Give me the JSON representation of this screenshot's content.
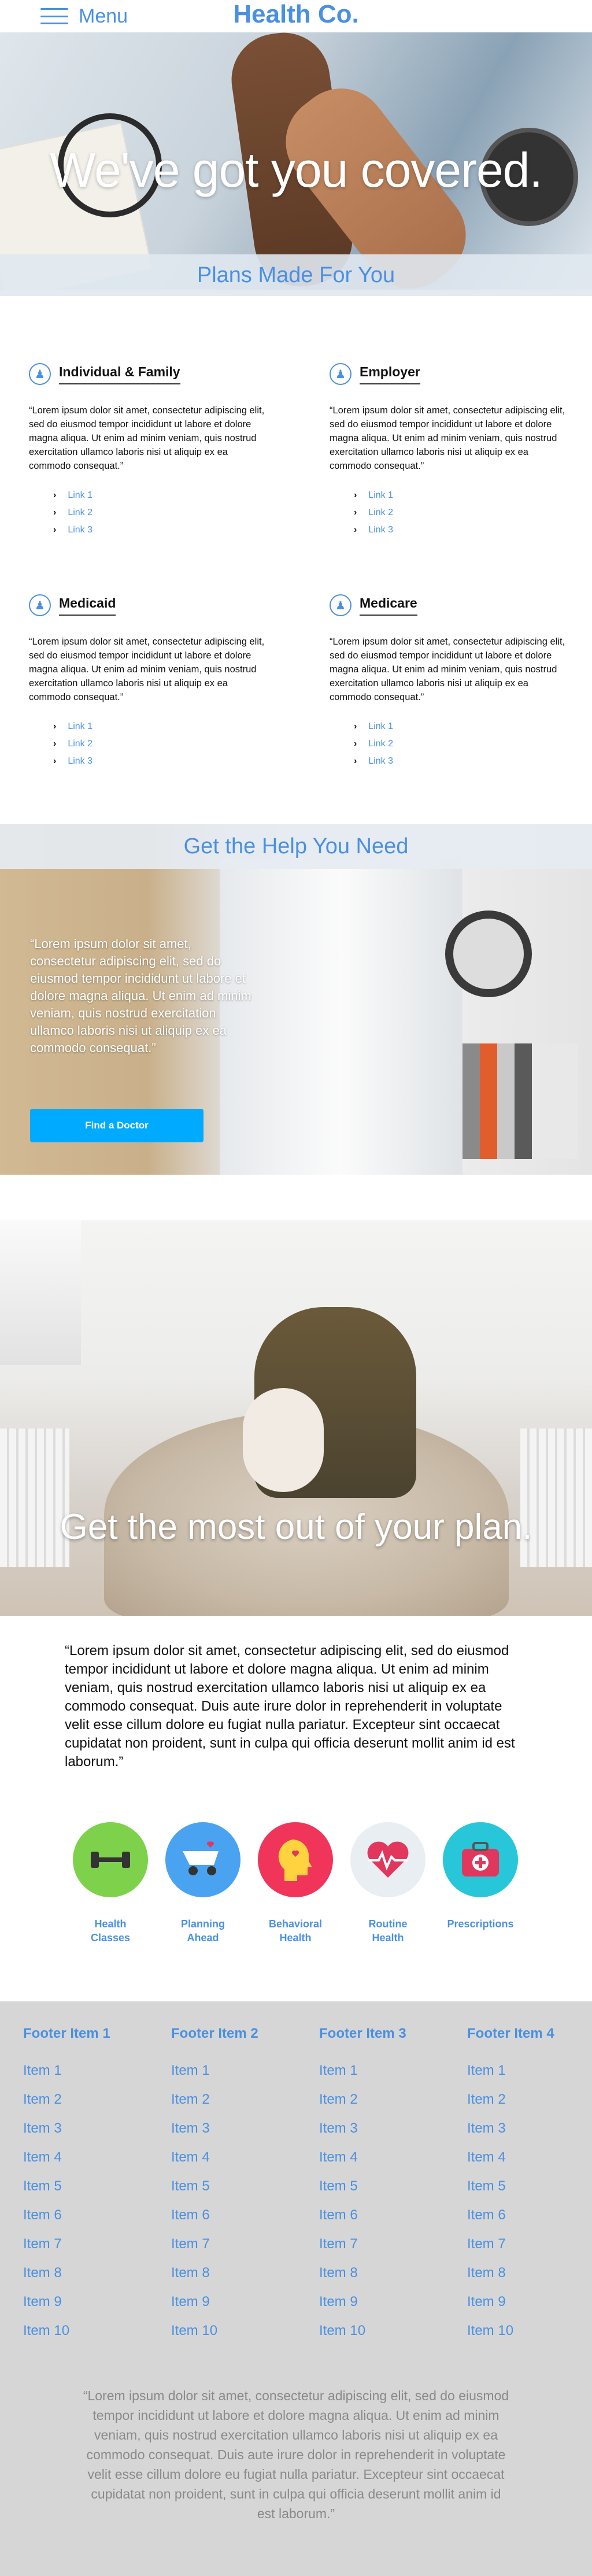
{
  "header": {
    "menu_label": "Menu",
    "brand": "Health Co."
  },
  "hero": {
    "title": "We've got you covered.",
    "section_heading": "Plans Made For You"
  },
  "plans": [
    {
      "title": "Individual & Family",
      "text": "“Lorem ipsum dolor sit amet, consectetur adipiscing elit, sed do eiusmod tempor incididunt ut labore et dolore magna aliqua. Ut enim ad minim veniam, quis nostrud exercitation ullamco laboris nisi ut aliquip ex ea commodo consequat.”",
      "links": [
        "Link 1",
        "Link 2",
        "Link 3"
      ]
    },
    {
      "title": "Employer",
      "text": "“Lorem ipsum dolor sit amet, consectetur adipiscing elit, sed do eiusmod tempor incididunt ut labore et dolore magna aliqua. Ut enim ad minim veniam, quis nostrud exercitation ullamco laboris nisi ut aliquip ex ea commodo consequat.”",
      "links": [
        "Link 1",
        "Link 2",
        "Link 3"
      ]
    },
    {
      "title": "Medicaid",
      "text": "“Lorem ipsum dolor sit amet, consectetur adipiscing elit, sed do eiusmod tempor incididunt ut labore et dolore magna aliqua. Ut enim ad minim veniam, quis nostrud exercitation ullamco laboris nisi ut aliquip ex ea commodo consequat.”",
      "links": [
        "Link 1",
        "Link 2",
        "Link 3"
      ]
    },
    {
      "title": "Medicare",
      "text": "“Lorem ipsum dolor sit amet, consectetur adipiscing elit, sed do eiusmod tempor incididunt ut labore et dolore magna aliqua. Ut enim ad minim veniam, quis nostrud exercitation ullamco laboris nisi ut aliquip ex ea commodo consequat.”",
      "links": [
        "Link 1",
        "Link 2",
        "Link 3"
      ]
    }
  ],
  "help": {
    "heading": "Get the Help You Need",
    "text": "“Lorem ipsum dolor sit amet, consectetur adipiscing elit, sed do eiusmod tempor incididunt ut labore et dolore magna aliqua. Ut enim ad minim veniam, quis nostrud exercitation ullamco laboris nisi ut aliquip ex ea commodo consequat.”",
    "button_label": "Find a Doctor"
  },
  "family": {
    "title": "Get the most out of your plan."
  },
  "quote": "“Lorem ipsum dolor sit amet, consectetur adipiscing elit, sed do eiusmod tempor incididunt ut labore et dolore magna aliqua. Ut enim ad minim veniam, quis nostrud exercitation ullamco laboris nisi ut aliquip ex ea commodo consequat. Duis aute irure dolor in reprehenderit in voluptate velit esse cillum dolore eu fugiat nulla pariatur. Excepteur sint occaecat cupidatat non proident, sunt in culpa qui officia deserunt mollit anim id est laborum.”",
  "features": [
    {
      "label_lines": [
        "Health",
        "Classes"
      ],
      "icon": "dumbbell-icon",
      "color": "#7ed14a"
    },
    {
      "label_lines": [
        "Planning",
        "Ahead"
      ],
      "icon": "stroller-icon",
      "color": "#4aa3f0"
    },
    {
      "label_lines": [
        "Behavioral",
        "Health"
      ],
      "icon": "head-heart-icon",
      "color": "#f0345a"
    },
    {
      "label_lines": [
        "Routine",
        "Health"
      ],
      "icon": "heartbeat-icon",
      "color": "#e9eef3"
    },
    {
      "label_lines": [
        "Prescriptions"
      ],
      "icon": "medkit-icon",
      "color": "#27c6d8"
    }
  ],
  "footer": {
    "columns": [
      {
        "heading": "Footer Item 1",
        "items": [
          "Item 1",
          "Item 2",
          "Item 3",
          "Item 4",
          "Item 5",
          "Item 6",
          "Item 7",
          "Item 8",
          "Item 9",
          "Item 10"
        ]
      },
      {
        "heading": "Footer Item 2",
        "items": [
          "Item 1",
          "Item 2",
          "Item 3",
          "Item 4",
          "Item 5",
          "Item 6",
          "Item 7",
          "Item 8",
          "Item 9",
          "Item 10"
        ]
      },
      {
        "heading": "Footer Item 3",
        "items": [
          "Item 1",
          "Item 2",
          "Item 3",
          "Item 4",
          "Item 5",
          "Item 6",
          "Item 7",
          "Item 8",
          "Item 9",
          "Item 10"
        ]
      },
      {
        "heading": "Footer Item 4",
        "items": [
          "Item 1",
          "Item 2",
          "Item 3",
          "Item 4",
          "Item 5",
          "Item 6",
          "Item 7",
          "Item 8",
          "Item 9",
          "Item 10"
        ]
      }
    ],
    "note": "“Lorem ipsum dolor sit amet, consectetur adipiscing elit, sed do eiusmod tempor incididunt ut labore et dolore magna aliqua. Ut enim ad minim veniam, quis nostrud exercitation ullamco laboris nisi ut aliquip ex ea commodo consequat. Duis aute irure dolor in reprehenderit in voluptate velit esse cillum dolore eu fugiat nulla pariatur. Excepteur sint occaecat cupidatat non proident, sunt in culpa qui officia deserunt mollit anim id est laborum.”"
  },
  "colors": {
    "accent": "#4a90e2",
    "button": "#00aaff",
    "footer_bg": "#d6d6d6"
  }
}
